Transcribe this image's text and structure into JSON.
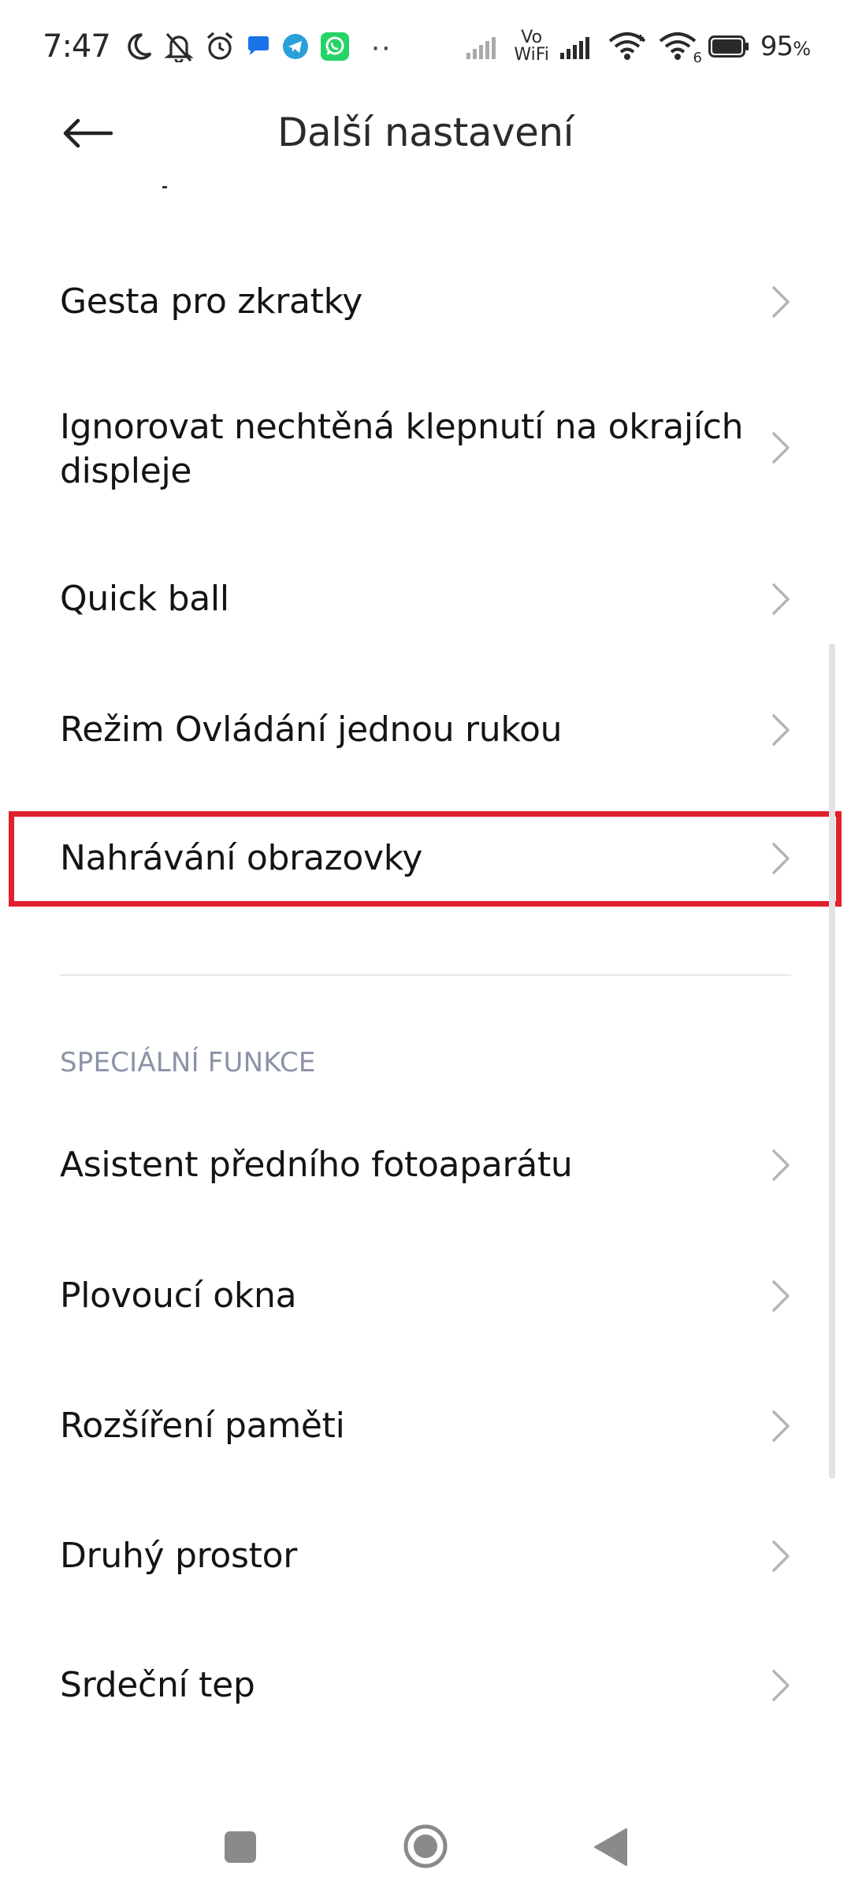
{
  "status_bar": {
    "time": "7:47",
    "battery_percent": "95",
    "battery_unit": "%",
    "vowifi_top": "Vo",
    "vowifi_bottom": "WiFi",
    "wifi6_label": "6",
    "notification_icons": [
      "moon-icon",
      "bell-off-icon",
      "alarm-icon",
      "message-icon",
      "telegram-icon",
      "whatsapp-icon",
      "more-dots-icon"
    ],
    "more_dots": "··"
  },
  "header": {
    "title": "Další nastavení"
  },
  "items": [
    {
      "label": "Gesta pro zkratky"
    },
    {
      "label": "Ignorovat nechtěná klepnutí na okrajích displeje"
    },
    {
      "label": "Quick ball"
    },
    {
      "label": "Režim Ovládání jednou rukou"
    },
    {
      "label": "Nahrávání obrazovky"
    }
  ],
  "special_section": {
    "header": "SPECIÁLNÍ FUNKCE",
    "items": [
      {
        "label": "Asistent předního fotoaparátu"
      },
      {
        "label": "Plovoucí okna"
      },
      {
        "label": "Rozšíření paměti"
      },
      {
        "label": "Druhý prostor"
      },
      {
        "label": "Srdeční tep"
      }
    ]
  },
  "colors": {
    "highlight": "#e0202e",
    "section_header": "#8b93a6",
    "whatsapp": "#25d366",
    "telegram": "#2aa0da",
    "messages": "#1a73e8"
  }
}
